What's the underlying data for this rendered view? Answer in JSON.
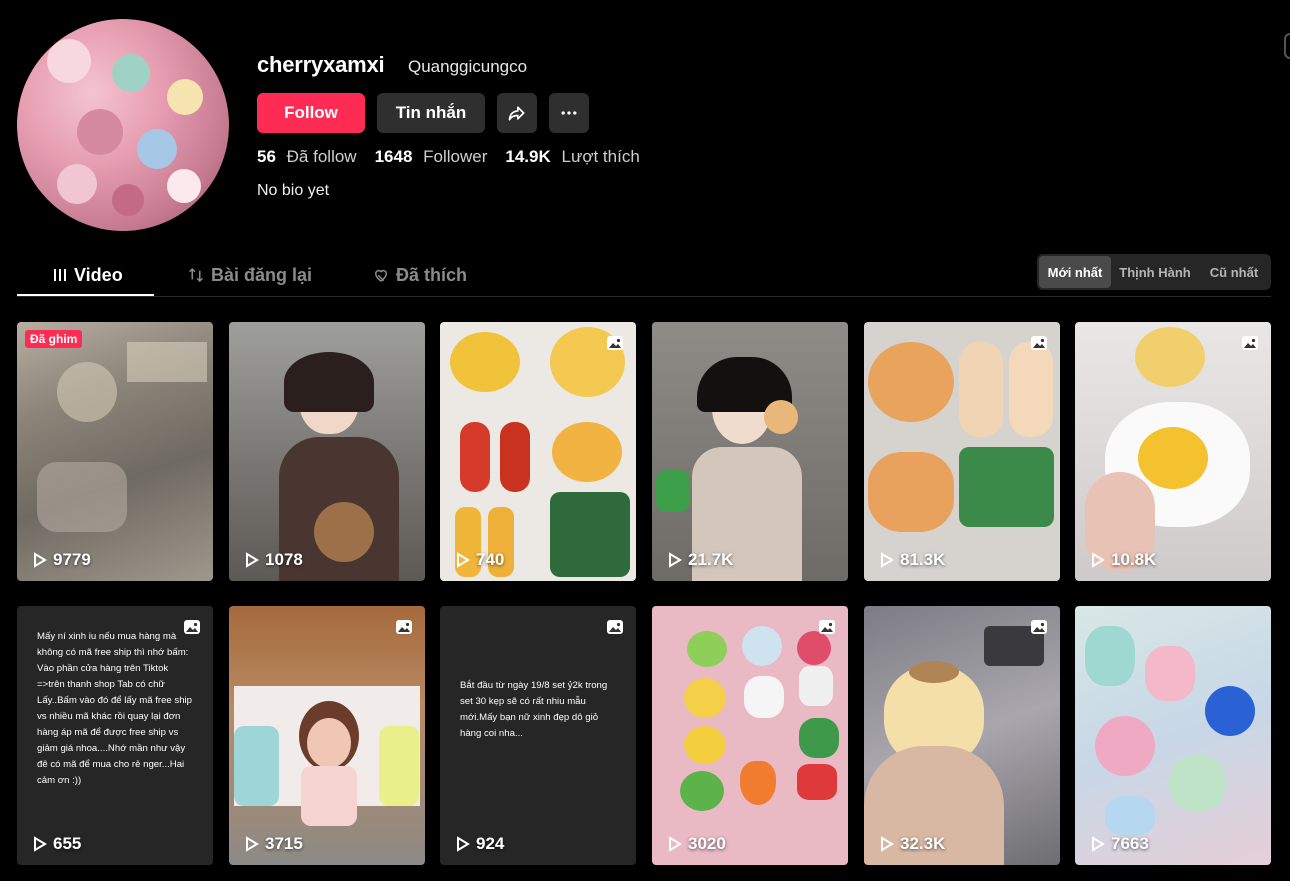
{
  "profile": {
    "username": "cherryxamxi",
    "nickname": "Quanggicungco",
    "bio": "No bio yet",
    "follow_label": "Follow",
    "message_label": "Tin nhắn",
    "stats": [
      {
        "value": "56",
        "label": "Đã follow"
      },
      {
        "value": "1648",
        "label": "Follower"
      },
      {
        "value": "14.9K",
        "label": "Lượt thích"
      }
    ]
  },
  "tabs": {
    "video": "Video",
    "repost": "Bài đăng lại",
    "liked": "Đã thích"
  },
  "sort": {
    "newest": "Mới nhất",
    "trending": "Thịnh Hành",
    "oldest": "Cũ nhất"
  },
  "videos": [
    {
      "views": "9779",
      "pinned": "Đã ghim"
    },
    {
      "views": "1078"
    },
    {
      "views": "740"
    },
    {
      "views": "21.7K"
    },
    {
      "views": "81.3K"
    },
    {
      "views": "10.8K"
    },
    {
      "views": "655",
      "caption": "Mấy ní xinh iu nếu mua hàng mà không có mã free ship thì nhớ bấm: Vào phần cửa hàng trên Tiktok =>trên thanh shop Tab có chữ Lấy..Bấm vào đó để lấy mã free ship vs nhiều mã khác rồi quay lại đơn hàng áp mã để được free ship vs giảm giá nhoa....Nhớ mần như vậy đê có mã để mua cho rẻ nger...Hai cảm ơn :))"
    },
    {
      "views": "3715"
    },
    {
      "views": "924",
      "caption": "Bắt đầu từ ngày 19/8 set ỷ2k trong set 30 kẹp sẽ có rất nhiu mẫu mới.Mấy bạn nữ xinh đẹp dô giỏ hàng coi nha..."
    },
    {
      "views": "3020"
    },
    {
      "views": "32.3K"
    },
    {
      "views": "7663"
    }
  ],
  "colors": {
    "accent": "#fe2c55",
    "button_bg": "#2f2f2f",
    "background": "#000000"
  }
}
